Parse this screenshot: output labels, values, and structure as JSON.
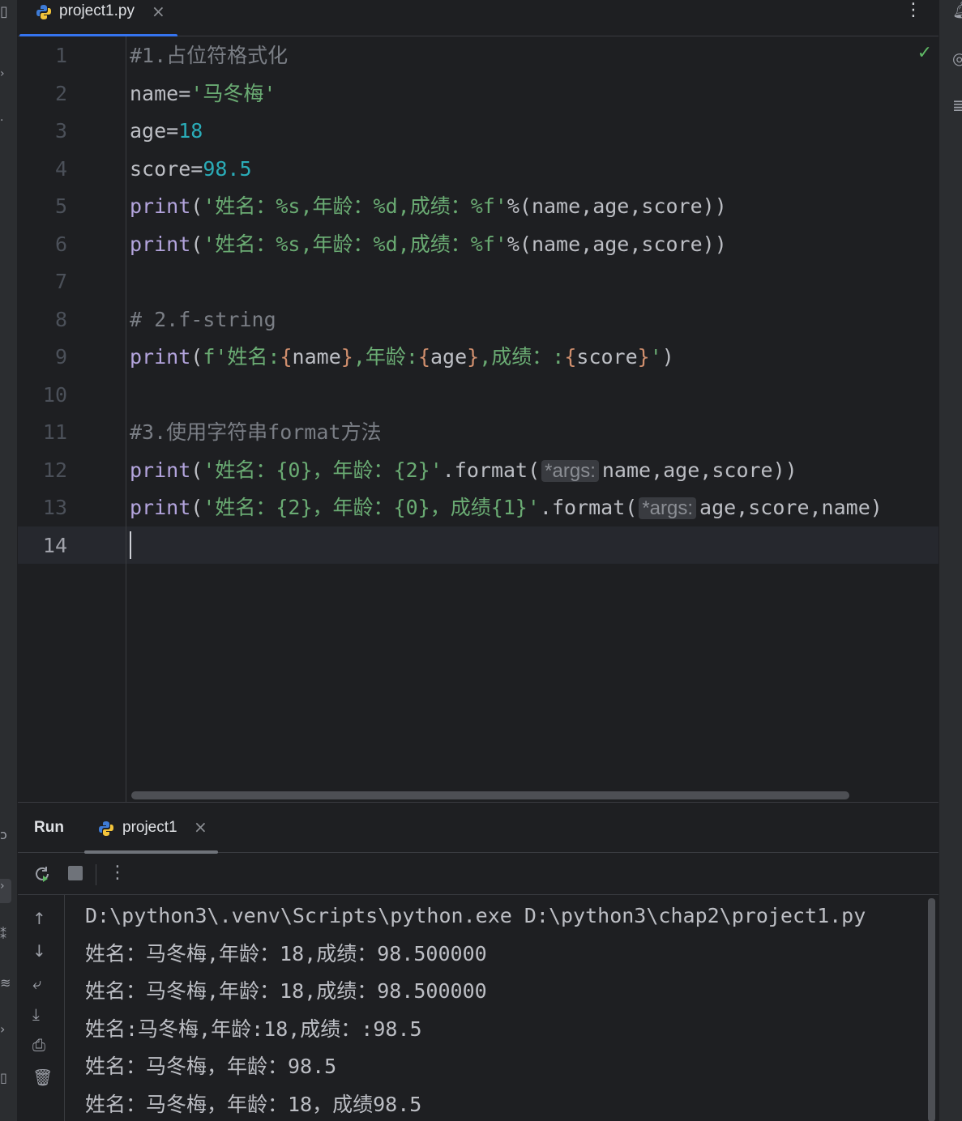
{
  "editor_tab": {
    "title": "project1.py",
    "close": "×"
  },
  "editor": {
    "lines": [
      {
        "no": "1",
        "segments": [
          {
            "cls": "comment",
            "text": "#1.占位符格式化"
          }
        ]
      },
      {
        "no": "2",
        "segments": [
          {
            "cls": "",
            "text": "name="
          },
          {
            "cls": "str",
            "text": "'马冬梅'"
          }
        ]
      },
      {
        "no": "3",
        "segments": [
          {
            "cls": "",
            "text": "age="
          },
          {
            "cls": "num",
            "text": "18"
          }
        ]
      },
      {
        "no": "4",
        "segments": [
          {
            "cls": "",
            "text": "score="
          },
          {
            "cls": "num",
            "text": "98.5"
          }
        ]
      },
      {
        "no": "5",
        "segments": [
          {
            "cls": "kw",
            "text": "print"
          },
          {
            "cls": "",
            "text": "("
          },
          {
            "cls": "str",
            "text": "'姓名：%s,年龄：%d,成绩：%f'"
          },
          {
            "cls": "",
            "text": "%(name,age,score))"
          }
        ]
      },
      {
        "no": "6",
        "segments": [
          {
            "cls": "kw",
            "text": "print"
          },
          {
            "cls": "",
            "text": "("
          },
          {
            "cls": "str",
            "text": "'姓名：%s,年龄：%d,成绩：%f'"
          },
          {
            "cls": "",
            "text": "%(name,age,score))"
          }
        ]
      },
      {
        "no": "7",
        "segments": []
      },
      {
        "no": "8",
        "segments": [
          {
            "cls": "comment",
            "text": "# 2.f-string"
          }
        ]
      },
      {
        "no": "9",
        "segments": [
          {
            "cls": "kw",
            "text": "print"
          },
          {
            "cls": "",
            "text": "("
          },
          {
            "cls": "str",
            "text": "f'姓名:"
          },
          {
            "cls": "brace",
            "text": "{"
          },
          {
            "cls": "",
            "text": "name"
          },
          {
            "cls": "brace",
            "text": "}"
          },
          {
            "cls": "str",
            "text": ",年龄:"
          },
          {
            "cls": "brace",
            "text": "{"
          },
          {
            "cls": "",
            "text": "age"
          },
          {
            "cls": "brace",
            "text": "}"
          },
          {
            "cls": "str",
            "text": ",成绩：:"
          },
          {
            "cls": "brace",
            "text": "{"
          },
          {
            "cls": "",
            "text": "score"
          },
          {
            "cls": "brace",
            "text": "}"
          },
          {
            "cls": "str",
            "text": "'"
          },
          {
            "cls": "",
            "text": ")"
          }
        ]
      },
      {
        "no": "10",
        "segments": []
      },
      {
        "no": "11",
        "segments": [
          {
            "cls": "comment",
            "text": "#3.使用字符串format方法"
          }
        ]
      },
      {
        "no": "12",
        "segments": [
          {
            "cls": "kw",
            "text": "print"
          },
          {
            "cls": "",
            "text": "("
          },
          {
            "cls": "str",
            "text": "'姓名：{0}，年龄：{2}'"
          },
          {
            "cls": "",
            "text": ".format("
          },
          {
            "cls": "inlay",
            "text": "*args:"
          },
          {
            "cls": "",
            "text": "name,age,score))"
          }
        ]
      },
      {
        "no": "13",
        "segments": [
          {
            "cls": "kw",
            "text": "print"
          },
          {
            "cls": "",
            "text": "("
          },
          {
            "cls": "str",
            "text": "'姓名：{2}，年龄：{0}，成绩{1}'"
          },
          {
            "cls": "",
            "text": ".format("
          },
          {
            "cls": "inlay",
            "text": "*args:"
          },
          {
            "cls": "",
            "text": "age,score,name)"
          }
        ]
      },
      {
        "no": "14",
        "segments": []
      }
    ]
  },
  "run_panel": {
    "label": "Run",
    "tab_title": "project1",
    "tab_close": "×",
    "output": [
      "D:\\python3\\.venv\\Scripts\\python.exe D:\\python3\\chap2\\project1.py",
      "姓名：马冬梅,年龄：18,成绩：98.500000",
      "姓名：马冬梅,年龄：18,成绩：98.500000",
      "姓名:马冬梅,年龄:18,成绩：:98.5",
      "姓名：马冬梅，年龄：98.5",
      "姓名：马冬梅，年龄：18，成绩98.5"
    ]
  },
  "colors": {
    "background": "#1e1f22",
    "accent_tab": "#3574f0",
    "keyword": "#b3a4dd",
    "string": "#6aab73",
    "number": "#2aacb8",
    "comment": "#7a7e85",
    "check": "#5fb865"
  },
  "icons": [
    "python-file-icon",
    "close-icon",
    "more-vertical-icon",
    "check-icon",
    "rerun-icon",
    "stop-icon",
    "arrow-up-icon",
    "arrow-down-icon",
    "soft-wrap-icon",
    "scroll-to-end-icon",
    "print-icon",
    "trash-icon",
    "bell-icon"
  ]
}
